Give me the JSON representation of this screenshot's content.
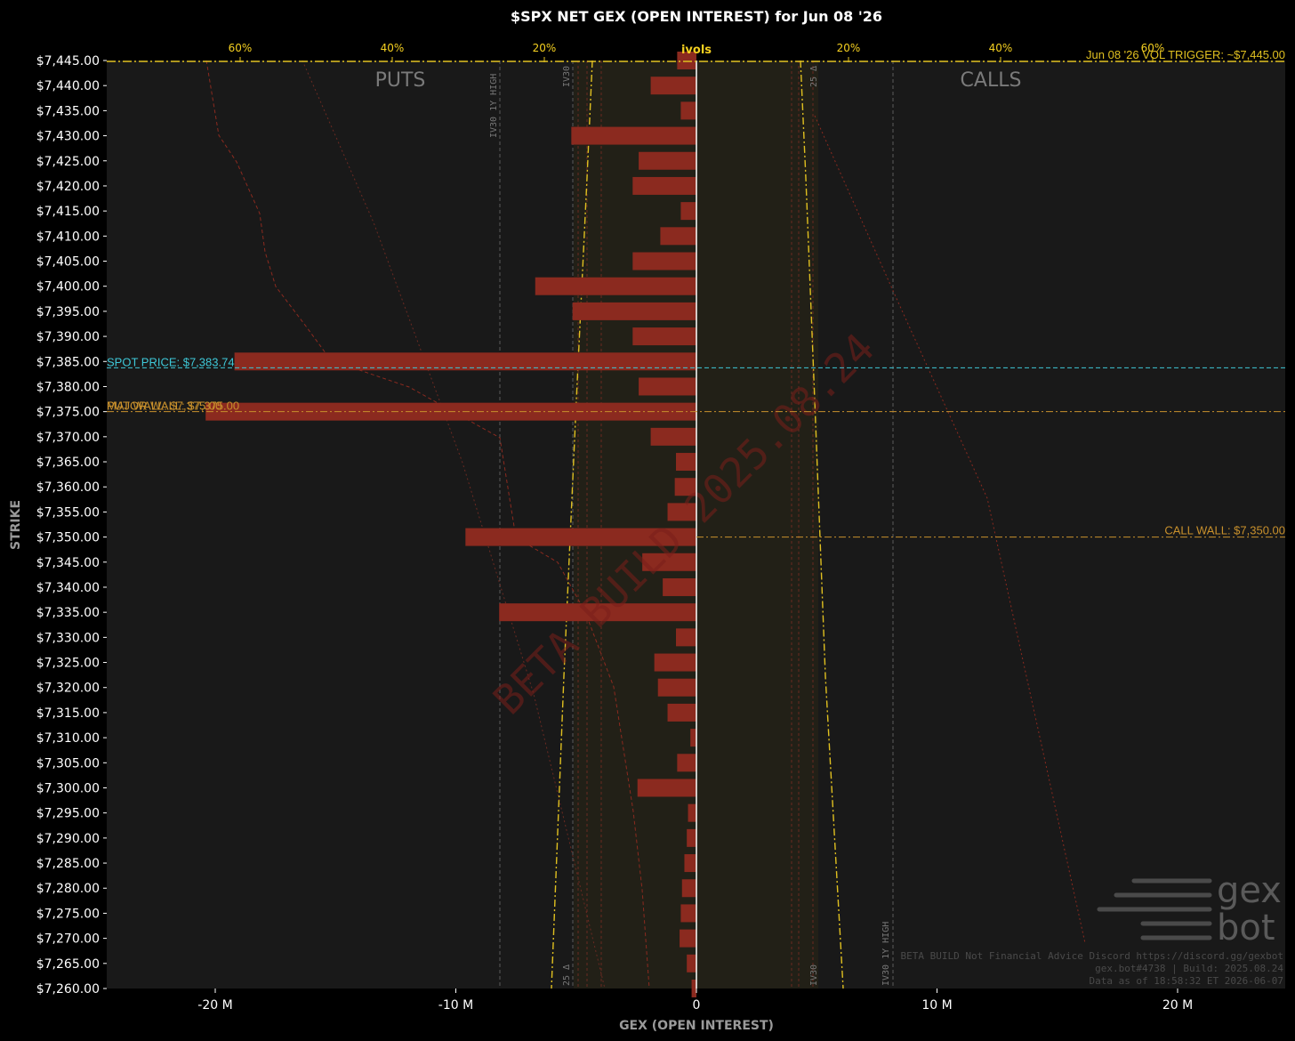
{
  "chart_data": {
    "type": "bar",
    "orientation": "horizontal",
    "title": "$SPX NET GEX (OPEN INTEREST) for Jun 08 '26",
    "xlabel": "GEX (OPEN INTEREST)",
    "ylabel": "STRIKE",
    "xlim": [
      -24.6,
      24.6
    ],
    "ylim": [
      7260,
      7445
    ],
    "xticks": [
      {
        "value": -20,
        "label": "-20 M"
      },
      {
        "value": -10,
        "label": "-10 M"
      },
      {
        "value": 0,
        "label": "0"
      },
      {
        "value": 10,
        "label": "10 M"
      },
      {
        "value": 20,
        "label": "20 M"
      }
    ],
    "strike_labels": [
      "$7,445.00",
      "$7,440.00",
      "$7,435.00",
      "$7,430.00",
      "$7,425.00",
      "$7,420.00",
      "$7,415.00",
      "$7,410.00",
      "$7,405.00",
      "$7,400.00",
      "$7,395.00",
      "$7,390.00",
      "$7,385.00",
      "$7,380.00",
      "$7,375.00",
      "$7,370.00",
      "$7,365.00",
      "$7,360.00",
      "$7,355.00",
      "$7,350.00",
      "$7,345.00",
      "$7,340.00",
      "$7,335.00",
      "$7,330.00",
      "$7,325.00",
      "$7,320.00",
      "$7,315.00",
      "$7,310.00",
      "$7,305.00",
      "$7,300.00",
      "$7,295.00",
      "$7,290.00",
      "$7,285.00",
      "$7,280.00",
      "$7,275.00",
      "$7,270.00",
      "$7,265.00",
      "$7,260.00"
    ],
    "strikes": [
      7445,
      7440,
      7435,
      7430,
      7425,
      7420,
      7415,
      7410,
      7405,
      7400,
      7395,
      7390,
      7385,
      7380,
      7375,
      7370,
      7365,
      7360,
      7355,
      7350,
      7345,
      7340,
      7335,
      7330,
      7325,
      7320,
      7315,
      7310,
      7305,
      7300,
      7295,
      7290,
      7285,
      7280,
      7275,
      7270,
      7265,
      7260
    ],
    "series": [
      {
        "values": [
          -0.8,
          -1.9,
          -0.65,
          -5.2,
          -2.4,
          -2.65,
          -0.65,
          -1.5,
          -2.65,
          -6.7,
          -5.15,
          -2.65,
          -19.2,
          -2.4,
          -20.4,
          -1.9,
          -0.85,
          -0.9,
          -1.2,
          -9.6,
          -2.25,
          -1.4,
          -8.2,
          -0.85,
          -1.75,
          -1.6,
          -1.2,
          -0.25,
          -0.8,
          -2.45,
          -0.35,
          -0.4,
          -0.5,
          -0.6,
          -0.65,
          -0.7,
          -0.4,
          -0.2
        ]
      }
    ],
    "ivols_axis": {
      "label": "ivols",
      "ticks_left": [
        "60%",
        "40%",
        "20%"
      ],
      "ticks_right": [
        "20%",
        "40%",
        "60%"
      ]
    },
    "side_labels": {
      "left": "PUTS",
      "right": "CALLS"
    },
    "reference_lines": {
      "spot_price": {
        "label": "SPOT PRICE: $7,383.74",
        "value": 7383.74,
        "color": "#3ec8d8"
      },
      "major_wall": {
        "label": "MAJOR WALL: $7,375.00",
        "value": 7375,
        "color": "#c8902c"
      },
      "put_wall": {
        "label": "PUT WALL: $7,375.00",
        "value": 7375,
        "color": "#c8902c"
      },
      "call_wall": {
        "label": "CALL WALL: $7,350.00",
        "value": 7350,
        "color": "#c8902c"
      },
      "vol_trigger": {
        "label": "Jun 08 '26 VOL TRIGGER: ~$7,445.00",
        "value": 7445,
        "color": "#e0c020"
      }
    },
    "vertical_markers": {
      "iv30_1y_high_left": "IV30 1Y HIGH",
      "iv30_left": "IV30",
      "delta25_left": "25 Δ",
      "delta25_right": "25 Δ",
      "iv30_right": "IV30",
      "iv30_1y_high_right": "IV30 1Y HIGH"
    },
    "watermark": "BETA BUILD 2025.08.24",
    "footer": [
      "BETA BUILD Not Financial Advice Discord https://discord.gg/gexbot",
      "gex.bot#4738 | Build: 2025.08.24",
      "Data as of 18:58:32 ET 2026-06-07"
    ],
    "logo": {
      "line1": "gex",
      "line2": "bot"
    },
    "colors": {
      "bar": "#8b2a1f",
      "background": "#191919",
      "page": "#000000",
      "zero_line": "#ffffff",
      "ivol": "#e0c020"
    }
  }
}
